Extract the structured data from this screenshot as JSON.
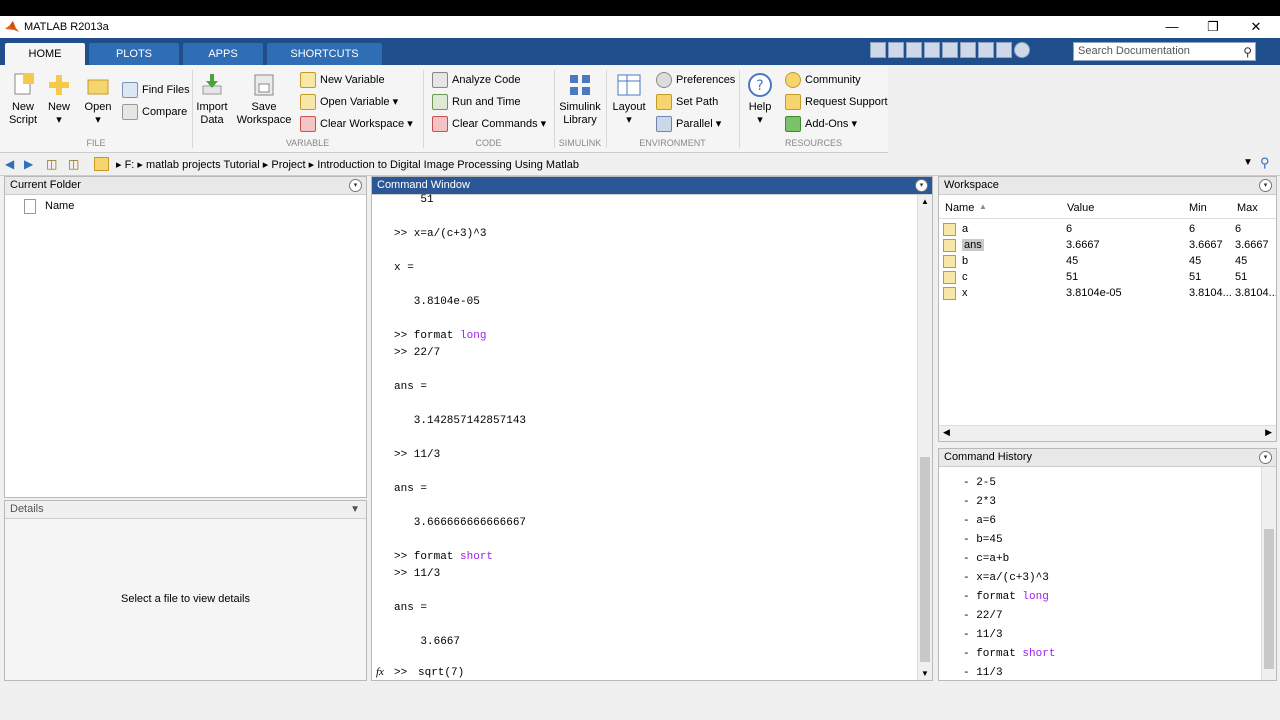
{
  "window": {
    "title": "MATLAB R2013a"
  },
  "tabs": [
    {
      "label": "HOME"
    },
    {
      "label": "PLOTS"
    },
    {
      "label": "APPS"
    },
    {
      "label": "SHORTCUTS"
    }
  ],
  "search": {
    "placeholder": "Search Documentation"
  },
  "ribbon": {
    "new_script": "New\nScript",
    "new": "New",
    "open": "Open",
    "find_files": "Find Files",
    "compare": "Compare",
    "import_data": "Import\nData",
    "save_workspace": "Save\nWorkspace",
    "new_variable": "New Variable",
    "open_variable": "Open Variable",
    "clear_workspace": "Clear Workspace",
    "analyze_code": "Analyze Code",
    "run_and_time": "Run and Time",
    "clear_commands": "Clear Commands",
    "simulink_library": "Simulink\nLibrary",
    "layout": "Layout",
    "preferences": "Preferences",
    "set_path": "Set Path",
    "parallel": "Parallel",
    "help": "Help",
    "community": "Community",
    "request_support": "Request Support",
    "add_ons": "Add-Ons",
    "groups": {
      "file": "FILE",
      "variable": "VARIABLE",
      "code": "CODE",
      "simulink": "SIMULINK",
      "environment": "ENVIRONMENT",
      "resources": "RESOURCES"
    }
  },
  "address": {
    "crumbs": [
      "F:",
      "matlab projects Tutorial",
      "Project",
      "Introduction to Digital Image Processing Using Matlab"
    ]
  },
  "current_folder": {
    "title": "Current Folder",
    "col_name": "Name"
  },
  "details": {
    "title": "Details",
    "empty": "Select a file to view details"
  },
  "command_window": {
    "title": "Command Window",
    "lines": [
      "    51",
      "",
      ">> x=a/(c+3)^3",
      "",
      "x =",
      "",
      "   3.8104e-05",
      "",
      ">> format long",
      ">> 22/7",
      "",
      "ans =",
      "",
      "   3.142857142857143",
      "",
      ">> 11/3",
      "",
      "ans =",
      "",
      "   3.666666666666667",
      "",
      ">> format short",
      ">> 11/3",
      "",
      "ans =",
      "",
      "    3.6667",
      ""
    ],
    "fx": "fx",
    "prompt": ">> ",
    "current_input": "sqrt(7)"
  },
  "workspace": {
    "title": "Workspace",
    "columns": [
      "Name",
      "Value",
      "Min",
      "Max"
    ],
    "rows": [
      {
        "name": "a",
        "value": "6",
        "min": "6",
        "max": "6"
      },
      {
        "name": "ans",
        "value": "3.6667",
        "min": "3.6667",
        "max": "3.6667"
      },
      {
        "name": "b",
        "value": "45",
        "min": "45",
        "max": "45"
      },
      {
        "name": "c",
        "value": "51",
        "min": "51",
        "max": "51"
      },
      {
        "name": "x",
        "value": "3.8104e-05",
        "min": "3.8104...",
        "max": "3.8104..."
      }
    ]
  },
  "history": {
    "title": "Command History",
    "items": [
      "2-5",
      "2*3",
      "a=6",
      "b=45",
      "c=a+b",
      "x=a/(c+3)^3",
      "format long",
      "22/7",
      "11/3",
      "format short",
      "11/3"
    ]
  }
}
